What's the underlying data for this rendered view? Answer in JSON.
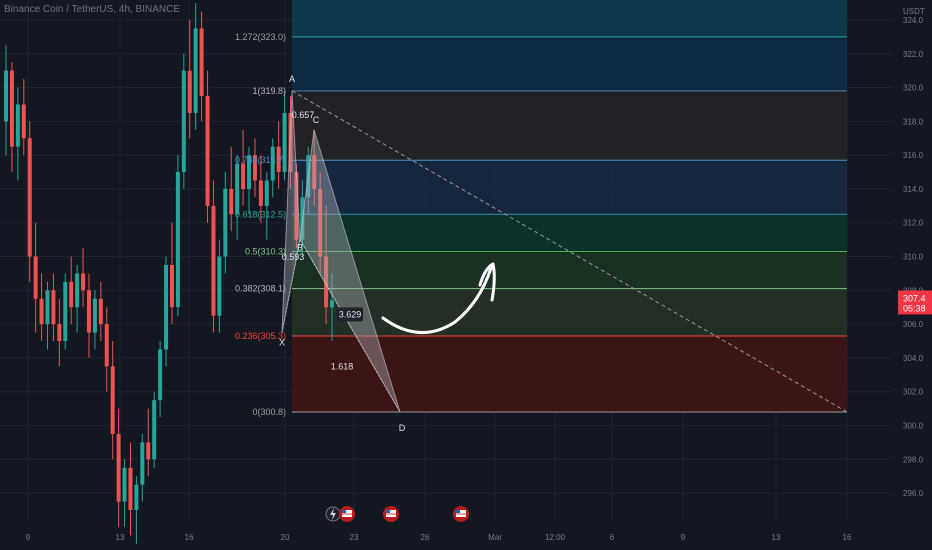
{
  "header": {
    "symbol_title": "Binance Coin / TetherUS, 4h, BINANCE"
  },
  "colors": {
    "background": "#131722",
    "grid": "#1f2330",
    "candle_up": "#26a69a",
    "candle_down": "#ef5350",
    "text": "#b2b5be",
    "axis_text": "#787b86",
    "price_tag": "#f23645"
  },
  "chart_data": {
    "type": "candlestick",
    "title": "Binance Coin / TetherUS, 4h, BINANCE",
    "currency_label": "USDT",
    "ylim": [
      295,
      325.3
    ],
    "price_ticks": [
      296.0,
      298.0,
      300.0,
      302.0,
      304.0,
      306.0,
      308.0,
      310.0,
      312.0,
      314.0,
      316.0,
      318.0,
      320.0,
      322.0,
      324.0
    ],
    "time_ticks": [
      "9",
      "13",
      "16",
      "20",
      "23",
      "26",
      "Mar",
      "12:00",
      "6",
      "9",
      "13",
      "16"
    ],
    "current_price": {
      "price": "307.4",
      "countdown": "05:38"
    },
    "fib_levels": [
      {
        "ratio": "1.272",
        "label": "1.272(323.0)",
        "price": 323.0,
        "fill": "#0d3b4d",
        "line": "#26a69a"
      },
      {
        "ratio": "1",
        "label": "1(319.8)",
        "price": 319.8,
        "fill": "#0e2a47",
        "line": "#5d7aa0"
      },
      {
        "ratio": "0.786",
        "label": "0.786(315.7)",
        "price": 315.7,
        "fill": "#222326",
        "line": "#4b93c5"
      },
      {
        "ratio": "0.618",
        "label": "0.618(312.5)",
        "price": 312.5,
        "fill": "#16283f",
        "line": "#2b8fa3"
      },
      {
        "ratio": "0.5",
        "label": "0.5(310.3)",
        "price": 310.3,
        "fill": "#0c3329",
        "line": "#4caf50"
      },
      {
        "ratio": "0.382",
        "label": "0.382(308.1)",
        "price": 308.1,
        "fill": "#1a3323",
        "line": "#81c784"
      },
      {
        "ratio": "0.236",
        "label": "0.236(305.3)",
        "price": 305.3,
        "fill": "#243026",
        "line": "#f44336"
      },
      {
        "ratio": "0",
        "label": "0(300.8)",
        "price": 300.8,
        "fill": "#3f1414",
        "line": "#9e9e9e"
      }
    ],
    "fib_label_colors": [
      "#9e9e9e",
      "#b2b5be",
      "#4b93c5",
      "#26a69a",
      "#81c784",
      "#b2b5be",
      "#f44336",
      "#9e9e9e"
    ],
    "harmonic_points": [
      {
        "label": "X",
        "price": 305.5
      },
      {
        "label": "A",
        "price": 319.8
      },
      {
        "label": "B",
        "price": 311.0
      },
      {
        "label": "C",
        "price": 317.5
      },
      {
        "label": "D",
        "price": 300.8
      }
    ],
    "harmonic_ratios": [
      "0.657",
      "0.593",
      "3.629",
      "1.618"
    ],
    "trend_line": {
      "from_price": 319.8,
      "to_price": 300.8
    },
    "projection_arrow": "up",
    "event_markers": [
      "lightning",
      "flag",
      "flag",
      "flag"
    ],
    "candles": [
      [
        318.0,
        322.5,
        316.0,
        321.0
      ],
      [
        321.0,
        321.5,
        315.0,
        316.5
      ],
      [
        316.5,
        320.0,
        314.5,
        319.0
      ],
      [
        319.0,
        320.5,
        316.0,
        317.0
      ],
      [
        317.0,
        318.0,
        308.5,
        310.0
      ],
      [
        310.0,
        312.0,
        305.5,
        307.5
      ],
      [
        307.5,
        309.0,
        305.0,
        306.0
      ],
      [
        306.0,
        308.5,
        304.5,
        308.0
      ],
      [
        308.0,
        309.0,
        305.0,
        306.0
      ],
      [
        306.0,
        307.5,
        303.5,
        305.0
      ],
      [
        305.0,
        309.0,
        304.5,
        308.5
      ],
      [
        308.5,
        310.0,
        306.0,
        307.0
      ],
      [
        307.0,
        309.5,
        305.5,
        309.0
      ],
      [
        309.0,
        310.5,
        307.0,
        308.0
      ],
      [
        308.0,
        309.0,
        304.0,
        305.5
      ],
      [
        305.5,
        308.0,
        304.5,
        307.5
      ],
      [
        307.5,
        308.5,
        305.0,
        306.0
      ],
      [
        306.0,
        307.0,
        302.0,
        303.5
      ],
      [
        303.5,
        305.0,
        298.0,
        299.5
      ],
      [
        299.5,
        301.0,
        294.0,
        295.5
      ],
      [
        295.5,
        298.0,
        294.0,
        297.5
      ],
      [
        297.5,
        299.0,
        293.5,
        295.0
      ],
      [
        295.0,
        297.0,
        293.0,
        296.5
      ],
      [
        296.5,
        299.5,
        295.5,
        299.0
      ],
      [
        299.0,
        301.0,
        297.0,
        298.0
      ],
      [
        298.0,
        302.0,
        297.5,
        301.5
      ],
      [
        301.5,
        305.0,
        300.5,
        304.5
      ],
      [
        304.5,
        310.0,
        303.5,
        309.5
      ],
      [
        309.5,
        312.0,
        306.0,
        307.0
      ],
      [
        307.0,
        316.0,
        306.5,
        315.0
      ],
      [
        315.0,
        322.0,
        314.0,
        321.0
      ],
      [
        321.0,
        324.0,
        317.0,
        318.5
      ],
      [
        318.5,
        325.0,
        317.5,
        323.5
      ],
      [
        323.5,
        324.5,
        318.0,
        319.5
      ],
      [
        319.5,
        321.0,
        312.0,
        313.0
      ],
      [
        313.0,
        314.5,
        305.5,
        306.5
      ],
      [
        306.5,
        311.0,
        305.5,
        310.0
      ],
      [
        310.0,
        315.0,
        309.0,
        314.0
      ],
      [
        314.0,
        316.5,
        311.5,
        312.5
      ],
      [
        312.5,
        316.0,
        311.0,
        315.5
      ],
      [
        315.5,
        317.5,
        313.0,
        314.0
      ],
      [
        314.0,
        316.5,
        312.5,
        316.0
      ],
      [
        316.0,
        317.0,
        313.5,
        314.5
      ],
      [
        314.5,
        316.0,
        312.0,
        313.0
      ],
      [
        313.0,
        315.0,
        311.0,
        314.5
      ],
      [
        314.5,
        317.0,
        313.5,
        316.5
      ],
      [
        316.5,
        318.0,
        314.0,
        315.0
      ],
      [
        315.0,
        319.8,
        314.5,
        318.5
      ],
      [
        318.5,
        319.5,
        314.0,
        315.0
      ],
      [
        315.0,
        315.5,
        310.5,
        311.0
      ],
      [
        311.0,
        314.5,
        310.0,
        313.5
      ],
      [
        313.5,
        316.5,
        312.5,
        316.0
      ],
      [
        316.0,
        317.5,
        313.0,
        314.0
      ],
      [
        314.0,
        315.0,
        309.0,
        310.0
      ],
      [
        310.0,
        313.0,
        306.0,
        307.0
      ],
      [
        307.0,
        309.0,
        305.0,
        307.4
      ]
    ]
  }
}
